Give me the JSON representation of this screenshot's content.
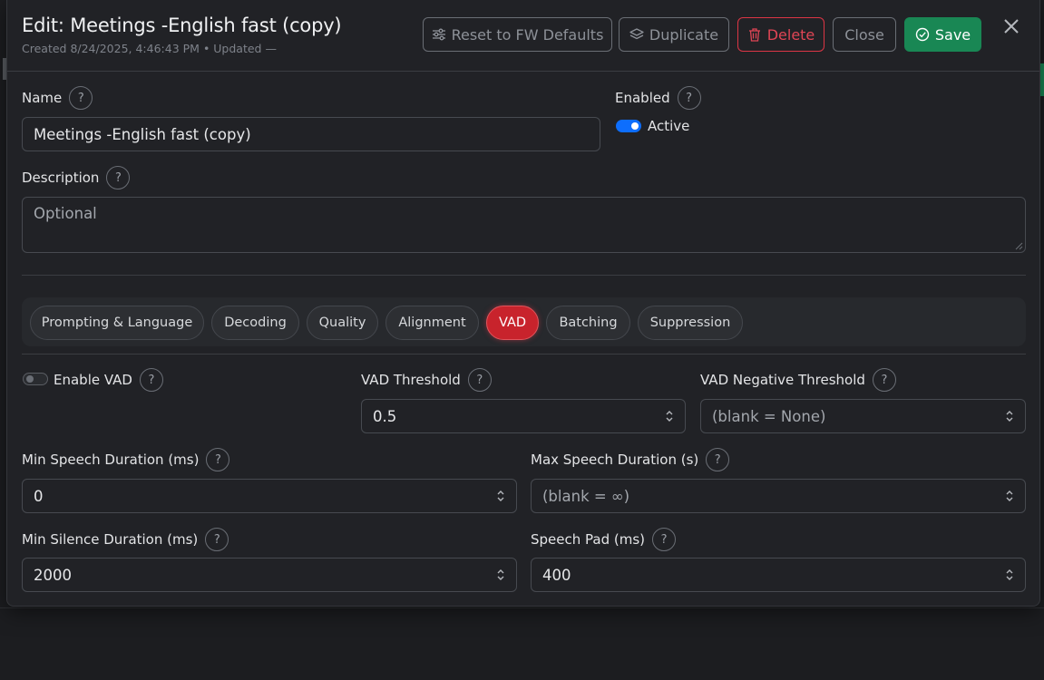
{
  "modal": {
    "title": "Edit: Meetings -English fast (copy)",
    "subtitle": "Created 8/24/2025, 4:46:43 PM • Updated —"
  },
  "toolbar": {
    "reset_label": "Reset to FW Defaults",
    "duplicate_label": "Duplicate",
    "delete_label": "Delete",
    "close_label": "Close",
    "save_label": "Save"
  },
  "help_glyph": "?",
  "form": {
    "name_label": "Name",
    "name_value": "Meetings -English fast (copy)",
    "enabled_label": "Enabled",
    "enabled_state": "Active",
    "enabled_on": true,
    "description_label": "Description",
    "description_placeholder": "Optional"
  },
  "tabs": [
    {
      "label": "Prompting & Language",
      "active": false
    },
    {
      "label": "Decoding",
      "active": false
    },
    {
      "label": "Quality",
      "active": false
    },
    {
      "label": "Alignment",
      "active": false
    },
    {
      "label": "VAD",
      "active": true
    },
    {
      "label": "Batching",
      "active": false
    },
    {
      "label": "Suppression",
      "active": false
    }
  ],
  "vad": {
    "enable_label": "Enable VAD",
    "enable_on": false,
    "threshold_label": "VAD Threshold",
    "threshold_value": "0.5",
    "neg_threshold_label": "VAD Negative Threshold",
    "neg_threshold_placeholder": "(blank = None)",
    "min_speech_label": "Min Speech Duration (ms)",
    "min_speech_value": "0",
    "max_speech_label": "Max Speech Duration (s)",
    "max_speech_placeholder": "(blank = ∞)",
    "min_silence_label": "Min Silence Duration (ms)",
    "min_silence_value": "2000",
    "speech_pad_label": "Speech Pad (ms)",
    "speech_pad_value": "400"
  },
  "colors": {
    "accent_blue": "#0d6efd",
    "danger": "#dc3545",
    "success": "#198754",
    "active_tab": "#c8232c"
  }
}
